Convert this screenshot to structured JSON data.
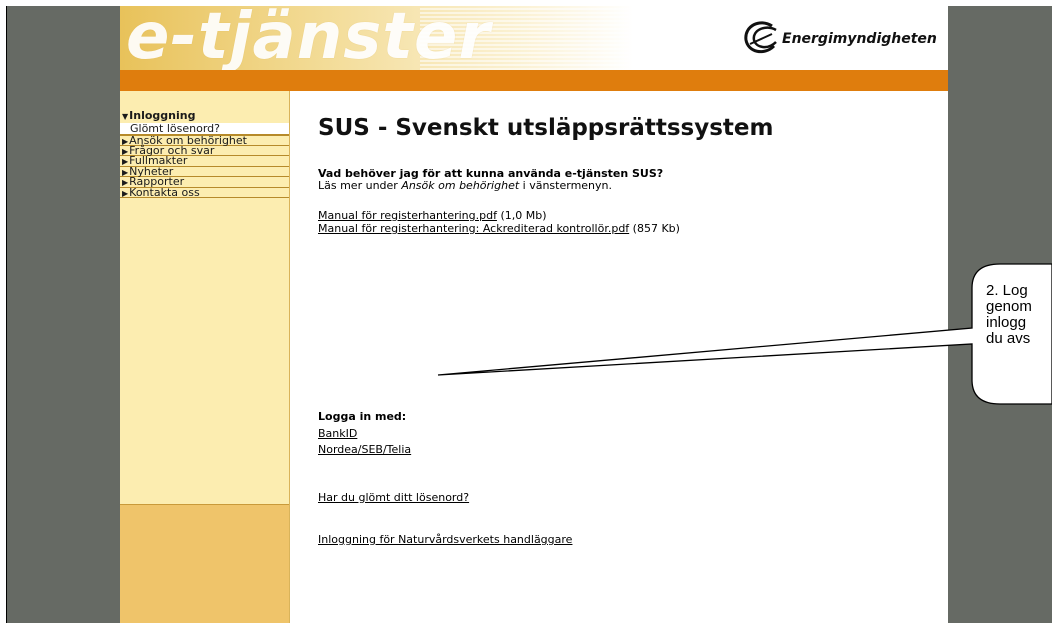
{
  "banner": {
    "title": "e-tjänster",
    "logo_text": "Energimyndigheten"
  },
  "sidebar": {
    "items": [
      {
        "label": "Inloggning",
        "type": "head"
      },
      {
        "label": "Glömt lösenord?",
        "type": "sub"
      },
      {
        "label": "Ansök om behörighet",
        "type": "item"
      },
      {
        "label": "Frågor och svar",
        "type": "item"
      },
      {
        "label": "Fullmakter",
        "type": "item"
      },
      {
        "label": "Nyheter",
        "type": "item"
      },
      {
        "label": "Rapporter",
        "type": "item"
      },
      {
        "label": "Kontakta oss",
        "type": "item"
      }
    ]
  },
  "main": {
    "title": "SUS - Svenskt utsläppsrättssystem",
    "question": "Vad behöver jag för att kunna använda e-tjänsten SUS?",
    "answer_prefix": "Läs mer under ",
    "answer_link": "Ansök om behörighet",
    "answer_suffix": " i vänstermenyn.",
    "documents": [
      {
        "label": "Manual för registerhantering.pdf",
        "size": "(1,0 Mb)"
      },
      {
        "label": "Manual för registerhantering: Ackrediterad kontrollör.pdf",
        "size": "(857 Kb)"
      }
    ],
    "login_label": "Logga in med:",
    "login_options": [
      "BankID",
      "Nordea/SEB/Telia"
    ],
    "forgot_link": "Har du glömt ditt lösenord?",
    "admin_link": "Inloggning för Naturvårdsverkets handläggare"
  },
  "callout": {
    "lines": [
      "2. Log",
      "genom",
      "inlogg",
      "du avs"
    ]
  },
  "colors": {
    "gray_side": "#666a64",
    "orange_bar": "#df7d0d",
    "sidebar_bg": "#fcedb0",
    "sidebar_bottom": "#efc46a"
  }
}
